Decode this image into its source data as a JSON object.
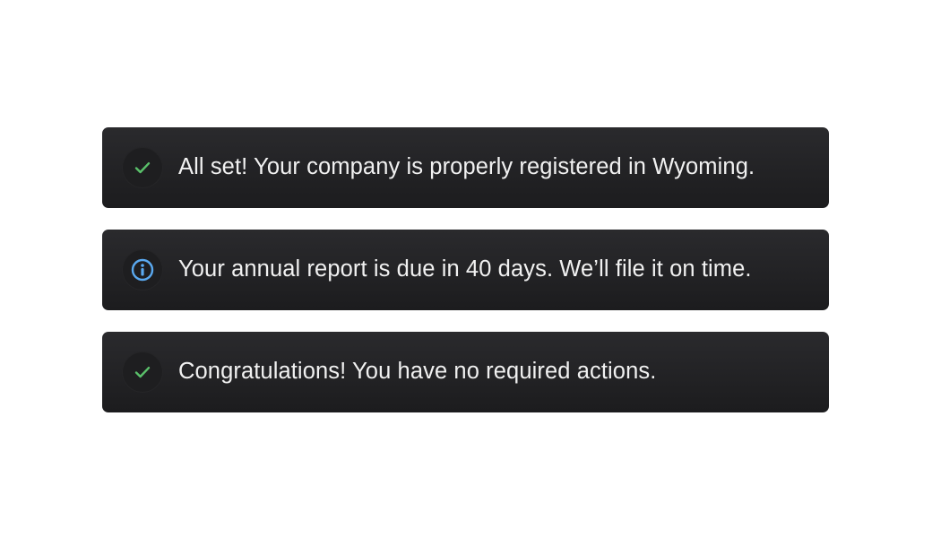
{
  "notices": [
    {
      "icon": "check-icon",
      "icon_color": "#5ac06a",
      "text": "All set! Your company is properly registered in Wyoming."
    },
    {
      "icon": "info-icon",
      "icon_color": "#5aa9f0",
      "text": "Your annual report is due in 40 days. We’ll file it on time."
    },
    {
      "icon": "check-icon",
      "icon_color": "#5ac06a",
      "text": "Congratulations! You have no required actions."
    }
  ]
}
